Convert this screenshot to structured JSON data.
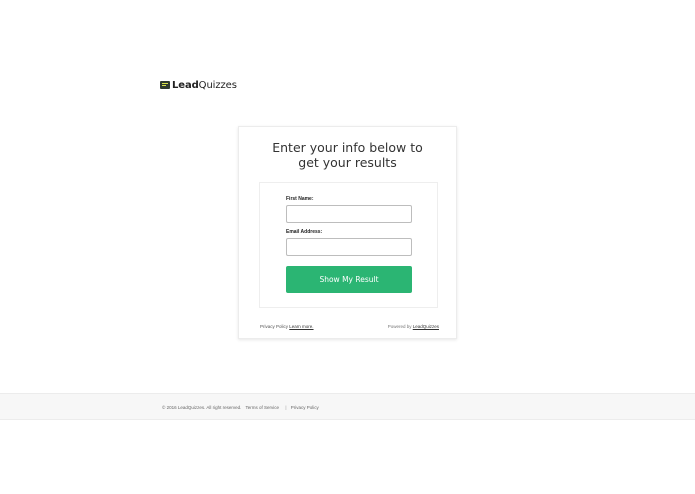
{
  "brand": {
    "name_bold": "Lead",
    "name_regular": "Quizzes",
    "icon": "quiz-logo-icon"
  },
  "card": {
    "title": "Enter your info below to get your results",
    "form": {
      "first_name_label": "First Name:",
      "first_name_value": "",
      "email_label": "Email Address:",
      "email_value": "",
      "submit_label": "Show My Result"
    },
    "footer": {
      "privacy_text": "Privacy Policy",
      "learn_more": "Learn more.",
      "powered_by": "Powered by",
      "powered_by_link": "LeadQuizzes"
    }
  },
  "page_footer": {
    "copyright": "© 2016 LeadQuizzes. All right reserved.",
    "terms": "Terms of Service",
    "separator": "|",
    "privacy": "Privacy Policy"
  },
  "colors": {
    "accent": "#2bb573",
    "footer_bg": "#f7f7f7"
  }
}
